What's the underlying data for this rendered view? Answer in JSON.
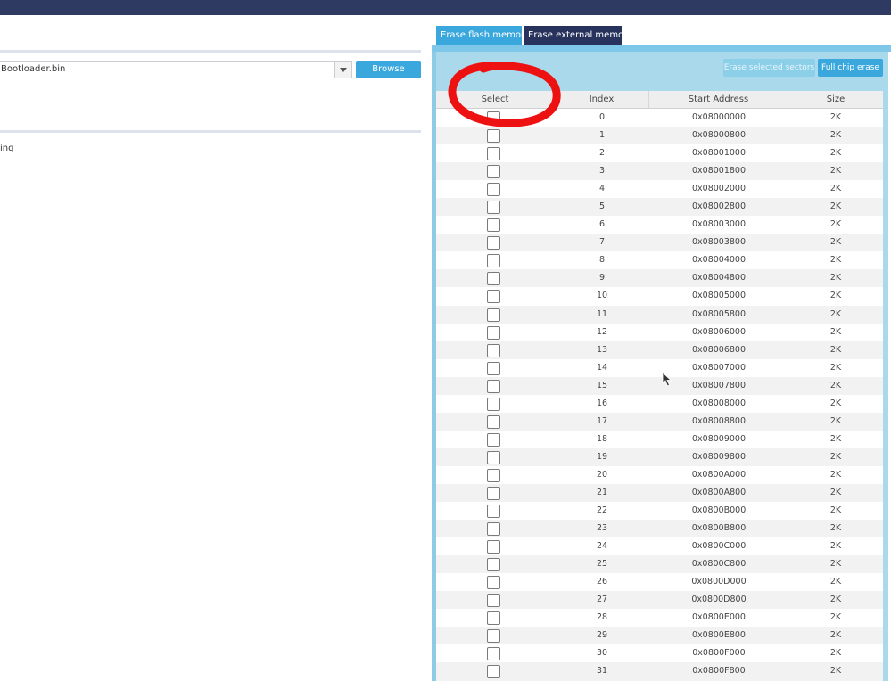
{
  "left_pane": {
    "file_value": "Bootloader.bin",
    "browse_label": "Browse",
    "text_fragment": "ing"
  },
  "tabs": [
    {
      "label": "Erase flash memory",
      "active": true
    },
    {
      "label": "Erase external memory",
      "active": false
    }
  ],
  "actions": {
    "erase_selected_label": "Erase selected sectors",
    "full_chip_erase_label": "Full chip erase"
  },
  "table": {
    "columns": [
      "Select",
      "Index",
      "Start Address",
      "Size"
    ],
    "rows": [
      {
        "index": "0",
        "address": "0x08000000",
        "size": "2K",
        "checked": false
      },
      {
        "index": "1",
        "address": "0x08000800",
        "size": "2K",
        "checked": false
      },
      {
        "index": "2",
        "address": "0x08001000",
        "size": "2K",
        "checked": false
      },
      {
        "index": "3",
        "address": "0x08001800",
        "size": "2K",
        "checked": false
      },
      {
        "index": "4",
        "address": "0x08002000",
        "size": "2K",
        "checked": false
      },
      {
        "index": "5",
        "address": "0x08002800",
        "size": "2K",
        "checked": false
      },
      {
        "index": "6",
        "address": "0x08003000",
        "size": "2K",
        "checked": false
      },
      {
        "index": "7",
        "address": "0x08003800",
        "size": "2K",
        "checked": false
      },
      {
        "index": "8",
        "address": "0x08004000",
        "size": "2K",
        "checked": false
      },
      {
        "index": "9",
        "address": "0x08004800",
        "size": "2K",
        "checked": false
      },
      {
        "index": "10",
        "address": "0x08005000",
        "size": "2K",
        "checked": false
      },
      {
        "index": "11",
        "address": "0x08005800",
        "size": "2K",
        "checked": false
      },
      {
        "index": "12",
        "address": "0x08006000",
        "size": "2K",
        "checked": false
      },
      {
        "index": "13",
        "address": "0x08006800",
        "size": "2K",
        "checked": false
      },
      {
        "index": "14",
        "address": "0x08007000",
        "size": "2K",
        "checked": false
      },
      {
        "index": "15",
        "address": "0x08007800",
        "size": "2K",
        "checked": false
      },
      {
        "index": "16",
        "address": "0x08008000",
        "size": "2K",
        "checked": false
      },
      {
        "index": "17",
        "address": "0x08008800",
        "size": "2K",
        "checked": false
      },
      {
        "index": "18",
        "address": "0x08009000",
        "size": "2K",
        "checked": false
      },
      {
        "index": "19",
        "address": "0x08009800",
        "size": "2K",
        "checked": false
      },
      {
        "index": "20",
        "address": "0x0800A000",
        "size": "2K",
        "checked": false
      },
      {
        "index": "21",
        "address": "0x0800A800",
        "size": "2K",
        "checked": false
      },
      {
        "index": "22",
        "address": "0x0800B000",
        "size": "2K",
        "checked": false
      },
      {
        "index": "23",
        "address": "0x0800B800",
        "size": "2K",
        "checked": false
      },
      {
        "index": "24",
        "address": "0x0800C000",
        "size": "2K",
        "checked": false
      },
      {
        "index": "25",
        "address": "0x0800C800",
        "size": "2K",
        "checked": false
      },
      {
        "index": "26",
        "address": "0x0800D000",
        "size": "2K",
        "checked": false
      },
      {
        "index": "27",
        "address": "0x0800D800",
        "size": "2K",
        "checked": false
      },
      {
        "index": "28",
        "address": "0x0800E000",
        "size": "2K",
        "checked": false
      },
      {
        "index": "29",
        "address": "0x0800E800",
        "size": "2K",
        "checked": false
      },
      {
        "index": "30",
        "address": "0x0800F000",
        "size": "2K",
        "checked": false
      },
      {
        "index": "31",
        "address": "0x0800F800",
        "size": "2K",
        "checked": false
      }
    ]
  },
  "colors": {
    "topbar": "#2f3a63",
    "accent": "#3aa7dd",
    "tab_inactive": "#27335d",
    "panel": "#aad9ec",
    "annotation": "#ee1111"
  },
  "icons": [
    "dropdown-arrow-icon",
    "checkbox-icon",
    "mouse-cursor-icon"
  ]
}
